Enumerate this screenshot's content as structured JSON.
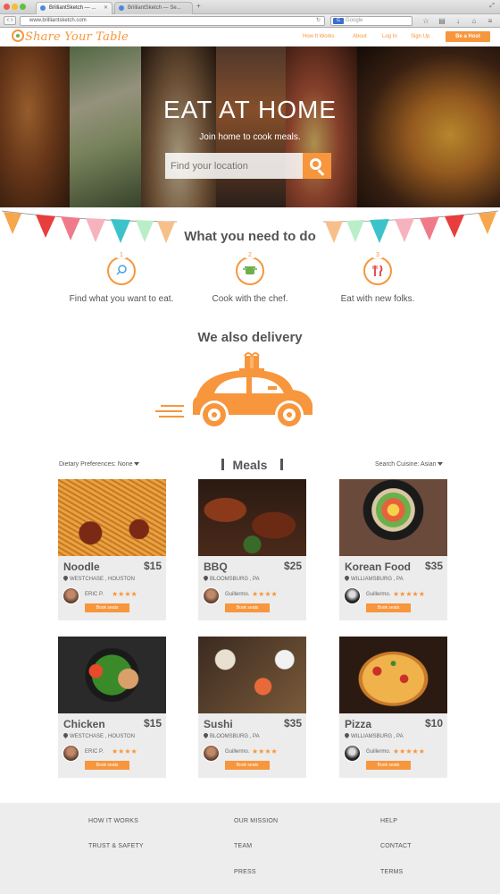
{
  "browser": {
    "tabs": [
      {
        "label": "BrilliantSketch — ..."
      },
      {
        "label": "BrilliantSketch — Se..."
      }
    ],
    "url": "www.brilliantsketch.com",
    "search_placeholder": "Google",
    "traffic_colors": [
      "#ee5b52",
      "#f5bd2f",
      "#5fc13d"
    ]
  },
  "site": {
    "logo_text": "Share Your Table",
    "nav": {
      "how_it_works": "How It Works",
      "about": "About",
      "login": "Log In",
      "signup": "Sign Up",
      "cta": "Be a Host"
    },
    "accent_color": "#f7963c"
  },
  "hero": {
    "title": "EAT AT HOME",
    "subtitle": "Join home to cook meals.",
    "search_placeholder": "Find your location"
  },
  "steps": {
    "title": "What  you need to do",
    "items": [
      {
        "num": "1",
        "text": "Find what you want to eat.",
        "icon": "search-icon"
      },
      {
        "num": "2",
        "text": "Cook with the chef.",
        "icon": "pot-icon"
      },
      {
        "num": "3",
        "text": "Eat with new folks.",
        "icon": "fork-knife-icon"
      }
    ]
  },
  "delivery": {
    "title": "We also delivery"
  },
  "meals": {
    "title": "Meals",
    "dietary_filter": "Dietary Preferences: None",
    "cuisine_filter": "Search Cuisine: Asian",
    "items": [
      {
        "name": "Noodle",
        "price": "$15",
        "location": "WESTCHASE , HOUSTON",
        "host": "ERIC P.",
        "stars": "★★★★",
        "book": "Book seats"
      },
      {
        "name": "BBQ",
        "price": "$25",
        "location": "BLOOMSBURG , PA",
        "host": "Guillermo.",
        "stars": "★★★★",
        "book": "Book seats"
      },
      {
        "name": "Korean Food",
        "price": "$35",
        "location": "WILLIAMSBURG , PA",
        "host": "Guillermo.",
        "stars": "★★★★★",
        "book": "Book seats"
      },
      {
        "name": "Chicken",
        "price": "$15",
        "location": "WESTCHASE , HOUSTON",
        "host": "ERIC P.",
        "stars": "★★★★",
        "book": "Book seats"
      },
      {
        "name": "Sushi",
        "price": "$35",
        "location": "BLOOMSBURG , PA",
        "host": "Guillermo.",
        "stars": "★★★★",
        "book": "Book seats"
      },
      {
        "name": "Pizza",
        "price": "$10",
        "location": "WILLIAMSBURG , PA",
        "host": "Guillermo.",
        "stars": "★★★★★",
        "book": "Book seats"
      }
    ]
  },
  "footer": {
    "links": {
      "how_it_works": "HOW IT WORKS",
      "trust_safety": "TRUST & SAFETY",
      "our_mission": "OUR MISSION",
      "team": "TEAM",
      "press": "PRESS",
      "help": "HELP",
      "contact": "CONTACT",
      "terms": "TERMS"
    }
  }
}
